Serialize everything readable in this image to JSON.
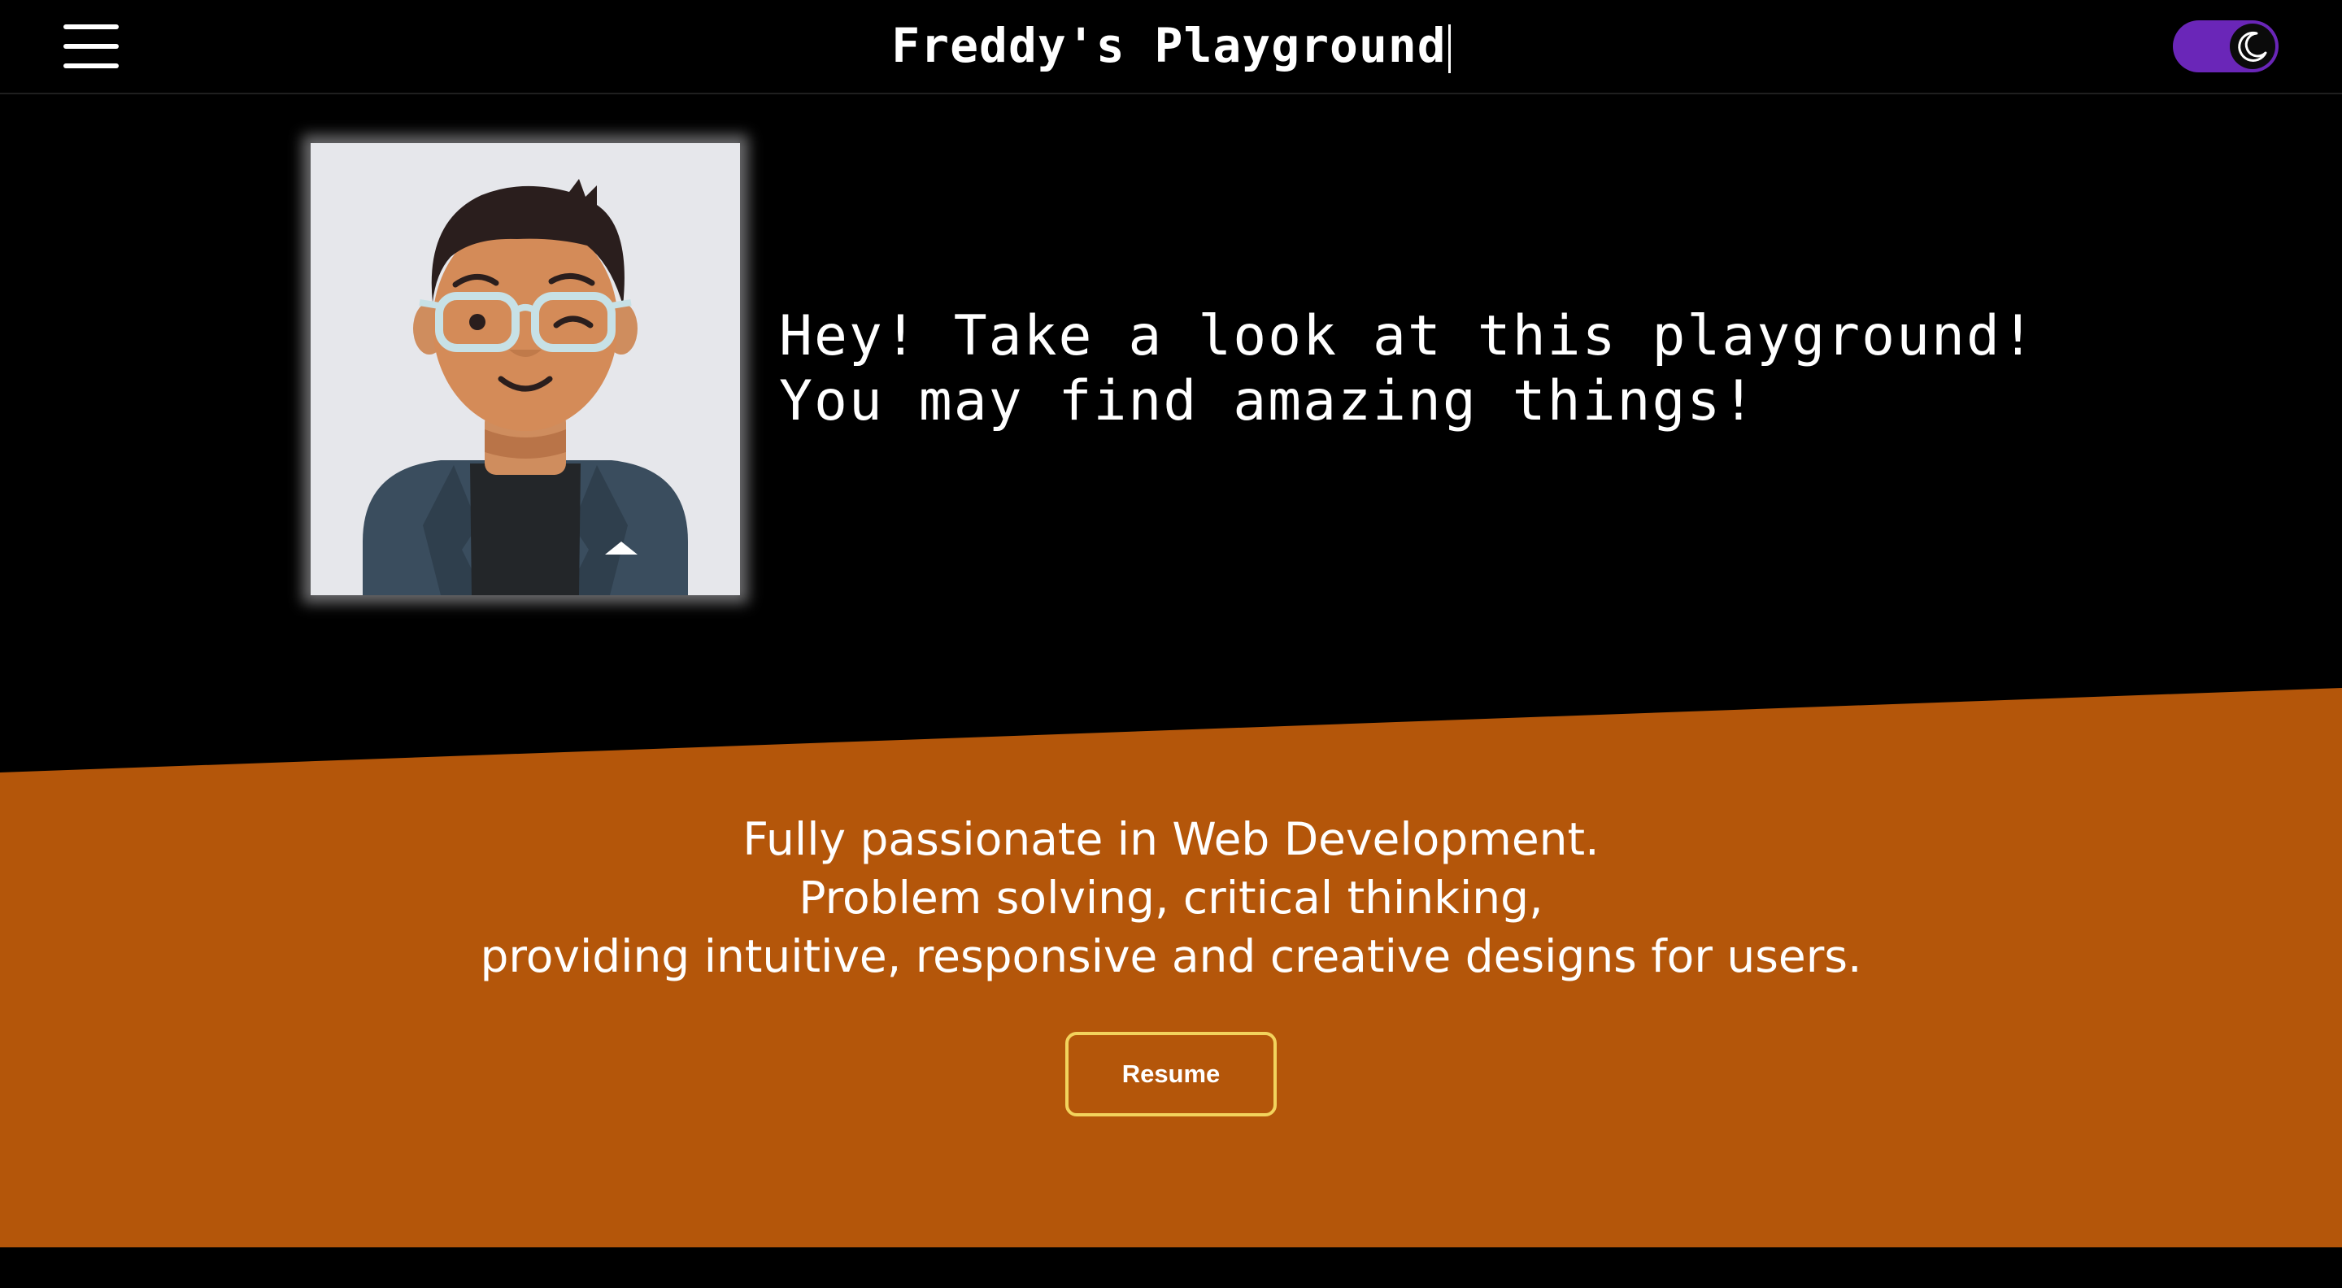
{
  "header": {
    "menu_icon": "hamburger-menu-icon",
    "title": "Freddy's Playground",
    "theme_toggle": {
      "icon": "moon-icon",
      "state": "dark",
      "accent_color": "#6a26b8"
    }
  },
  "hero": {
    "avatar_icon": "avatar-illustration",
    "greeting_line1": "Hey! Take a look at this playground!",
    "greeting_line2": "You may find amazing things!"
  },
  "about": {
    "line1": "Fully passionate in Web Development.",
    "line2": "Problem solving, critical thinking,",
    "line3": "providing intuitive, responsive and creative designs for users.",
    "background_color": "#b45309",
    "resume_label": "Resume",
    "resume_border_color": "#f3d35c"
  }
}
